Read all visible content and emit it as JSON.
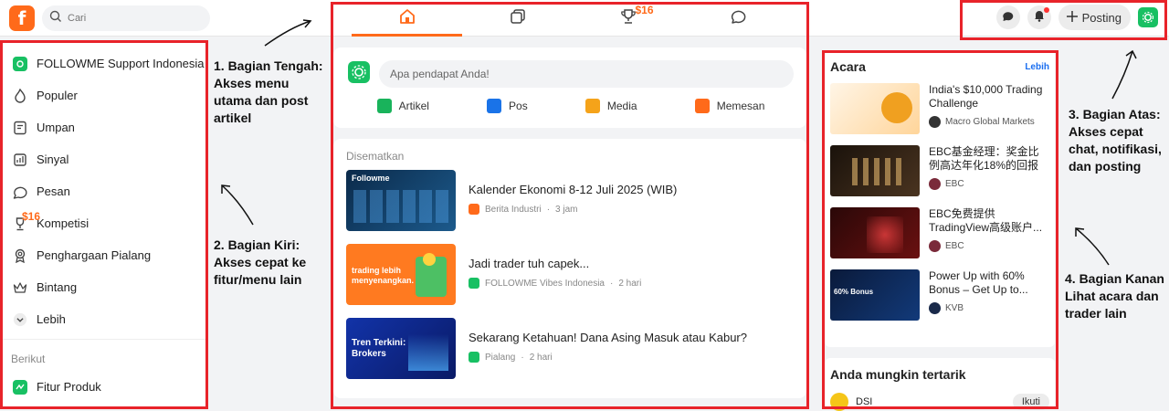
{
  "header": {
    "logo_letter": "f",
    "search_placeholder": "Cari",
    "tab_badge": "$16",
    "post_label": "Posting"
  },
  "sidebar": {
    "items": [
      {
        "label": "FOLLOWME Support Indonesia",
        "icon": "group-avatar-icon"
      },
      {
        "label": "Populer",
        "icon": "flame-icon"
      },
      {
        "label": "Umpan",
        "icon": "feed-icon"
      },
      {
        "label": "Sinyal",
        "icon": "signal-icon"
      },
      {
        "label": "Pesan",
        "icon": "chat-icon"
      },
      {
        "label": "Kompetisi",
        "icon": "trophy-icon"
      },
      {
        "label": "Penghargaan Pialang",
        "icon": "award-icon"
      },
      {
        "label": "Bintang",
        "icon": "crown-icon"
      },
      {
        "label": "Lebih",
        "icon": "chevron-down-icon"
      }
    ],
    "badge": "$16",
    "section_label": "Berikut",
    "follow_items": [
      {
        "label": "Fitur Produk",
        "icon": "product-icon"
      }
    ]
  },
  "compose": {
    "placeholder": "Apa pendapat Anda!",
    "actions": [
      {
        "label": "Artikel",
        "color": "#19b35b"
      },
      {
        "label": "Pos",
        "color": "#1a73e8"
      },
      {
        "label": "Media",
        "color": "#f5a31a"
      },
      {
        "label": "Memesan",
        "color": "#ff6a1a"
      }
    ]
  },
  "pinned": {
    "title": "Disematkan",
    "items": [
      {
        "title": "Kalender Ekonomi 8-12 Juli 2025 (WIB)",
        "source": "Berita Industri",
        "time": "3 jam",
        "thumb_text": "Followme",
        "source_color": "#ff6a1a"
      },
      {
        "title": "Jadi trader tuh capek...",
        "source": "FOLLOWME Vibes Indonesia",
        "time": "2 hari",
        "thumb_text": "trading lebih menyenangkan.",
        "source_color": "#18c063"
      },
      {
        "title": "Sekarang Ketahuan! Dana Asing Masuk atau Kabur?",
        "source": "Pialang",
        "time": "2 hari",
        "thumb_text": "Tren Terkini: Brokers",
        "source_color": "#18c063"
      }
    ]
  },
  "events": {
    "title": "Acara",
    "more": "Lebih",
    "items": [
      {
        "title": "India's $10,000 Trading Challenge",
        "source": "Macro Global Markets"
      },
      {
        "title": "EBC基金经理：奖金比例高达年化18%的回报",
        "source": "EBC"
      },
      {
        "title": "EBC免费提供TradingView高级账户...",
        "source": "EBC"
      },
      {
        "title": "Power Up with 60% Bonus – Get Up to...",
        "source": "KVB",
        "thumb_text": "60% Bonus"
      }
    ]
  },
  "suggest": {
    "title": "Anda mungkin tertarik",
    "name": "DSI",
    "follow_label": "Ikuti"
  },
  "annotations": [
    {
      "text": "1. Bagian Tengah: Akses menu utama dan post artikel"
    },
    {
      "text": "2. Bagian Kiri: Akses cepat ke fitur/menu lain"
    },
    {
      "text": "3. Bagian Atas: Akses cepat chat, notifikasi, dan posting"
    },
    {
      "text": "4. Bagian Kanan Lihat acara dan trader lain"
    }
  ],
  "colors": {
    "brand": "#ff6a1a",
    "highlight": "#e8232a",
    "green": "#18c063",
    "link": "#1a6ef0"
  }
}
